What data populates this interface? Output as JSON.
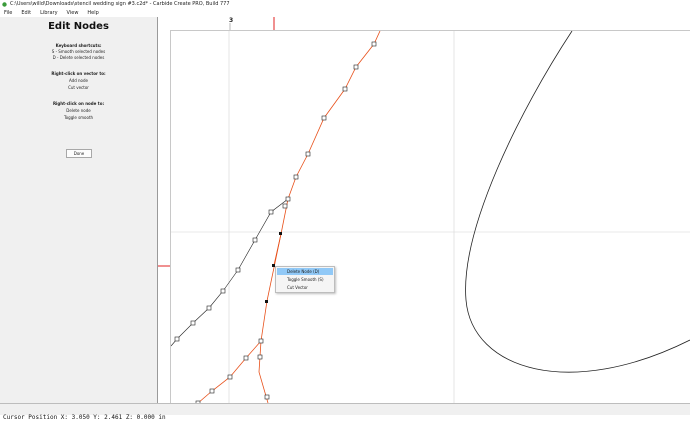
{
  "window": {
    "title": "C:\\Users\\willd\\Downloads\\stencil wedding sign #3.c2d* - Carbide Create PRO, Build 777"
  },
  "menu": [
    "File",
    "Edit",
    "Library",
    "View",
    "Help"
  ],
  "panel": {
    "title": "Edit Nodes",
    "shortcuts_heading": "Keyboard shortcuts:",
    "shortcuts": [
      "S - Smooth selected nodes",
      "D - Delete selected nodes"
    ],
    "vector_heading": "Right-click on vector to:",
    "vector_actions": [
      "Add node",
      "Cut vector"
    ],
    "node_heading": "Right-click on node to:",
    "node_actions": [
      "Delete node",
      "Toggle smooth"
    ],
    "done_label": "Done"
  },
  "ruler": {
    "top_label": "3"
  },
  "context_menu": {
    "items": [
      "Delete Node (D)",
      "Toggle Smooth (S)",
      "Cut Vector"
    ],
    "highlighted": 0
  },
  "status": {
    "text": "Cursor Position X: 3.050 Y: 2.461 Z: 0.000 in"
  },
  "colors": {
    "path_selected": "#e8501a",
    "path_default": "#222222",
    "highlight": "#91c9f7",
    "ruler_marker": "#e02020"
  }
}
